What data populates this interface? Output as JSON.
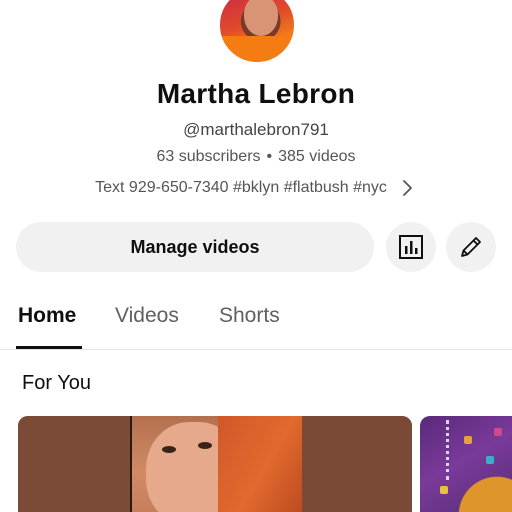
{
  "profile": {
    "name": "Martha Lebron",
    "handle": "@marthalebron791",
    "subscribers": "63 subscribers",
    "separator": "•",
    "videos": "385 videos",
    "description": "Text 929-650-7340 #bklyn #flatbush #nyc"
  },
  "actions": {
    "manage_label": "Manage videos",
    "analytics_icon": "analytics-icon",
    "edit_icon": "pencil-icon"
  },
  "tabs": [
    {
      "label": "Home",
      "active": true
    },
    {
      "label": "Videos",
      "active": false
    },
    {
      "label": "Shorts",
      "active": false
    }
  ],
  "section": {
    "title": "For You"
  },
  "colors": {
    "primary_text": "#0f0f0f",
    "secondary_text": "#606060",
    "button_bg": "#f1f1f1"
  }
}
